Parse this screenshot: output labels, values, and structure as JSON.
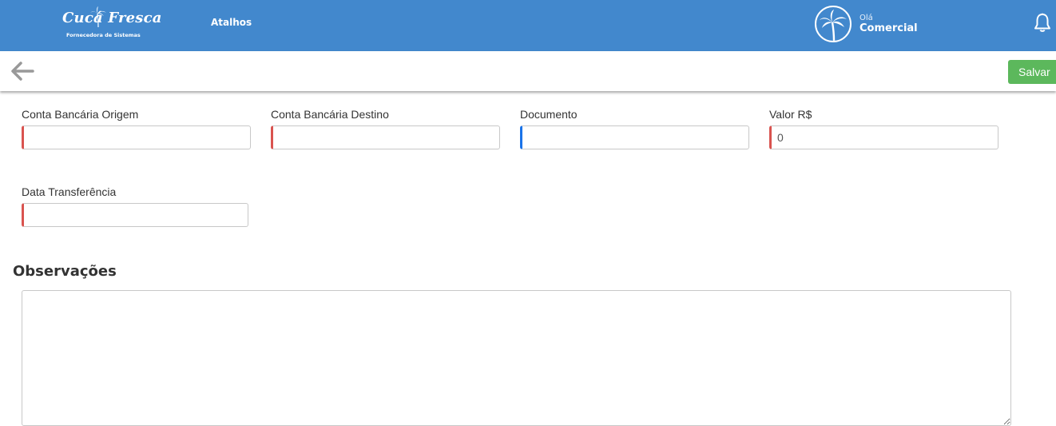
{
  "header": {
    "logo_text": "Cucá Fresca",
    "logo_subtitle": "Fornecedora de Sistemas",
    "shortcuts_label": "Atalhos",
    "greeting": "Olá",
    "user_name": "Comercial",
    "bell_icon": "bell-icon",
    "color": "#4288cd"
  },
  "toolbar": {
    "back_icon": "arrow-left-icon",
    "save_label": "Salvar",
    "save_color": "#5cb85c"
  },
  "form": {
    "origin_account": {
      "label": "Conta Bancária Origem",
      "value": ""
    },
    "destination_account": {
      "label": "Conta Bancária Destino",
      "value": ""
    },
    "document": {
      "label": "Documento",
      "value": ""
    },
    "amount": {
      "label": "Valor R$",
      "value": "0"
    },
    "transfer_date": {
      "label": "Data Transferência",
      "value": ""
    },
    "required_color": "#d9534f",
    "optional_color": "#1a73e8"
  },
  "notes": {
    "title": "Observações",
    "value": ""
  }
}
